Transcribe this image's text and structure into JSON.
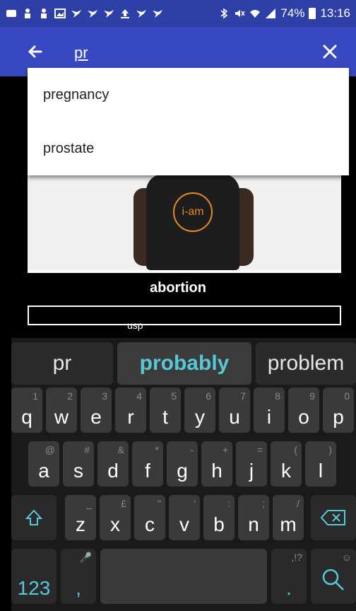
{
  "status_bar": {
    "battery": "74%",
    "time": "13:16"
  },
  "app_bar": {
    "search_value": "pr"
  },
  "suggestions": [
    "pregnancy",
    "prostate"
  ],
  "content": {
    "caption": "abortion",
    "ghost": "usp"
  },
  "keyboard": {
    "strip": [
      "pr",
      "probably",
      "problem"
    ],
    "row1": [
      {
        "k": "q",
        "h": "1"
      },
      {
        "k": "w",
        "h": "2"
      },
      {
        "k": "e",
        "h": "3"
      },
      {
        "k": "r",
        "h": "4"
      },
      {
        "k": "t",
        "h": "5"
      },
      {
        "k": "y",
        "h": "6"
      },
      {
        "k": "u",
        "h": "7"
      },
      {
        "k": "i",
        "h": "8"
      },
      {
        "k": "o",
        "h": "9"
      },
      {
        "k": "p",
        "h": "0"
      }
    ],
    "row2": [
      {
        "k": "a",
        "h": "@"
      },
      {
        "k": "s",
        "h": "#"
      },
      {
        "k": "d",
        "h": "&"
      },
      {
        "k": "f",
        "h": "*"
      },
      {
        "k": "g",
        "h": "-"
      },
      {
        "k": "h",
        "h": "+"
      },
      {
        "k": "j",
        "h": "="
      },
      {
        "k": "k",
        "h": "("
      },
      {
        "k": "l",
        "h": ")"
      }
    ],
    "row3": [
      {
        "k": "z",
        "h": "_"
      },
      {
        "k": "x",
        "h": "£"
      },
      {
        "k": "c",
        "h": "\""
      },
      {
        "k": "v",
        "h": "'"
      },
      {
        "k": "b",
        "h": ":"
      },
      {
        "k": "n",
        "h": ";"
      },
      {
        "k": "m",
        "h": "/"
      }
    ],
    "row4": {
      "numbers": "123",
      "comma": ",",
      "period": ".",
      "comma_hint": "🎤",
      "period_hint": ",!?"
    }
  }
}
